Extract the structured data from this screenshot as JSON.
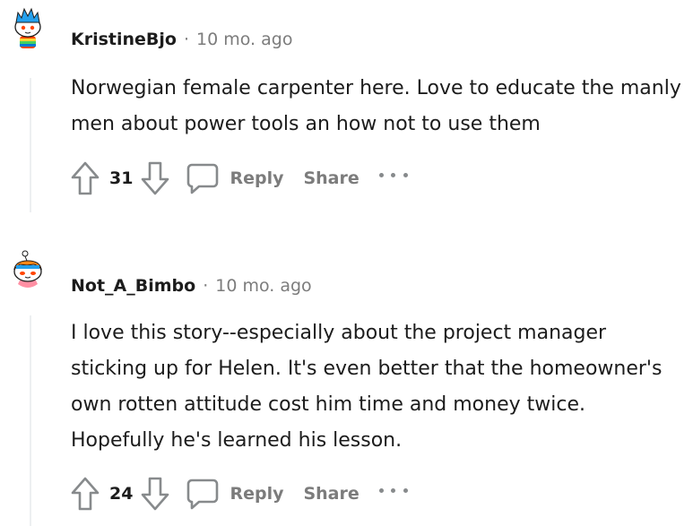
{
  "comments": [
    {
      "author": "KristineBjo",
      "separator": "·",
      "time": "10 mo. ago",
      "body": "Norwegian female carpenter here. Love to educate the manly men about power tools an how not to use them",
      "score": "31",
      "reply_label": "Reply",
      "share_label": "Share",
      "avatar": "snoo-avatar-blue-hair-rainbow-jacket"
    },
    {
      "author": "Not_A_Bimbo",
      "separator": "·",
      "time": "10 mo. ago",
      "body": "I love this story--especially about the project manager sticking up for Helen. It's even better that the homeowner's own rotten attitude cost him time and money twice. Hopefully he's learned his lesson.",
      "score": "24",
      "reply_label": "Reply",
      "share_label": "Share",
      "avatar": "snoo-avatar-orange-hair-headband"
    }
  ],
  "icons": {
    "upvote": "upvote-arrow-icon",
    "downvote": "downvote-arrow-icon",
    "reply": "speech-bubble-icon",
    "more": "more-options-icon"
  },
  "colors": {
    "text": "#1c1c1c",
    "muted": "#7c7c7c",
    "thread_line": "#edeff1",
    "icon": "#878a8c"
  }
}
